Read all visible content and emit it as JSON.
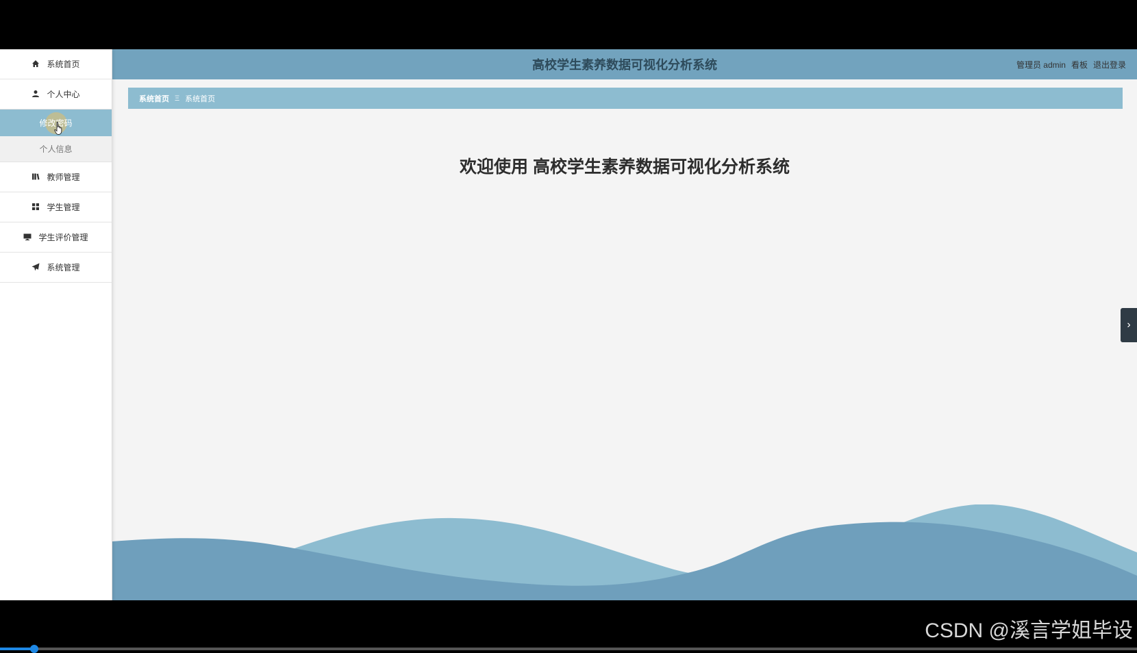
{
  "header": {
    "title": "高校学生素养数据可视化分析系统",
    "user": "管理员 admin",
    "board": "看板",
    "logout": "退出登录"
  },
  "sidebar": {
    "items": [
      {
        "label": "系统首页",
        "icon": "home-icon"
      },
      {
        "label": "个人中心",
        "icon": "user-icon"
      },
      {
        "label": "修改密码",
        "icon": "",
        "active": true
      },
      {
        "label": "个人信息",
        "icon": "",
        "sub": true
      },
      {
        "label": "教师管理",
        "icon": "book-icon"
      },
      {
        "label": "学生管理",
        "icon": "grid-icon"
      },
      {
        "label": "学生评价管理",
        "icon": "monitor-icon"
      },
      {
        "label": "系统管理",
        "icon": "send-icon"
      }
    ]
  },
  "breadcrumb": {
    "home": "系统首页",
    "separator": "Ξ",
    "current": "系统首页"
  },
  "main": {
    "welcome": "欢迎使用 高校学生素养数据可视化分析系统"
  },
  "side_tab": {
    "icon": "chevron-right-icon",
    "glyph": "›"
  },
  "watermark": "CSDN @溪言学姐毕设",
  "video_progress": {
    "fraction": 0.03
  },
  "colors": {
    "primary": "#72a3be",
    "accent": "#8dbcd0",
    "background": "#f4f4f4"
  }
}
